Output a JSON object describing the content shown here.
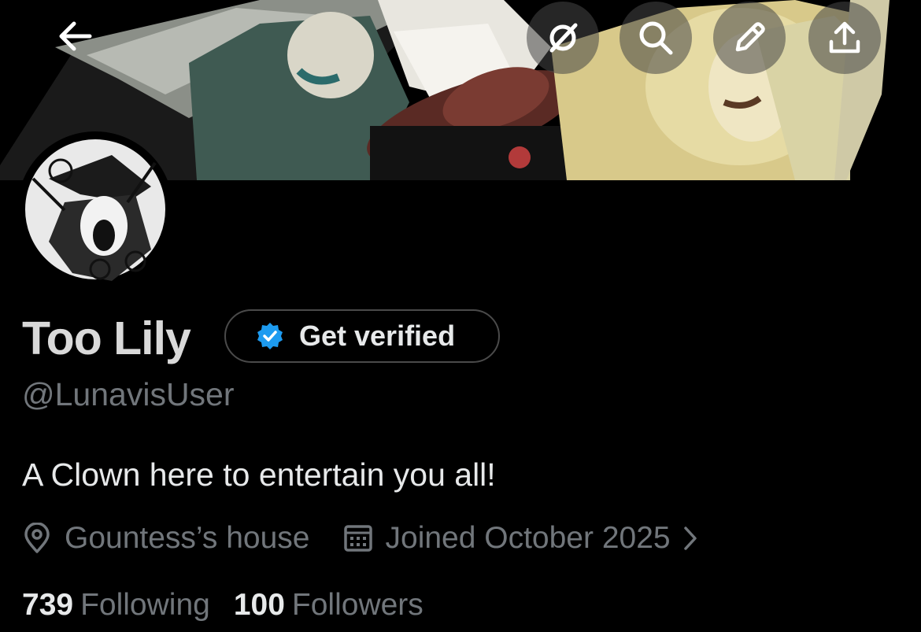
{
  "icons": {
    "back": "arrow-left-icon",
    "grok": "grok-icon",
    "search": "search-icon",
    "edit": "pencil-icon",
    "share": "share-upload-icon",
    "verified": "verified-badge-icon",
    "location": "location-pin-icon",
    "calendar": "calendar-icon",
    "chevron": "chevron-right-icon"
  },
  "colors": {
    "background": "#000000",
    "primary_text": "#e7e9ea",
    "secondary_text": "#71767b",
    "verified_blue": "#1d9bf0",
    "pill_border": "#4a4a4a"
  },
  "profile": {
    "display_name": "Too Lily",
    "verify_label": "Get verified",
    "handle": "@LunavisUser",
    "bio": "A Clown here to entertain you all!",
    "location": "Gountess’s house",
    "joined": "Joined October 2025"
  },
  "stats": {
    "following_count": "739",
    "following_label": "Following",
    "followers_count": "100",
    "followers_label": "Followers"
  }
}
